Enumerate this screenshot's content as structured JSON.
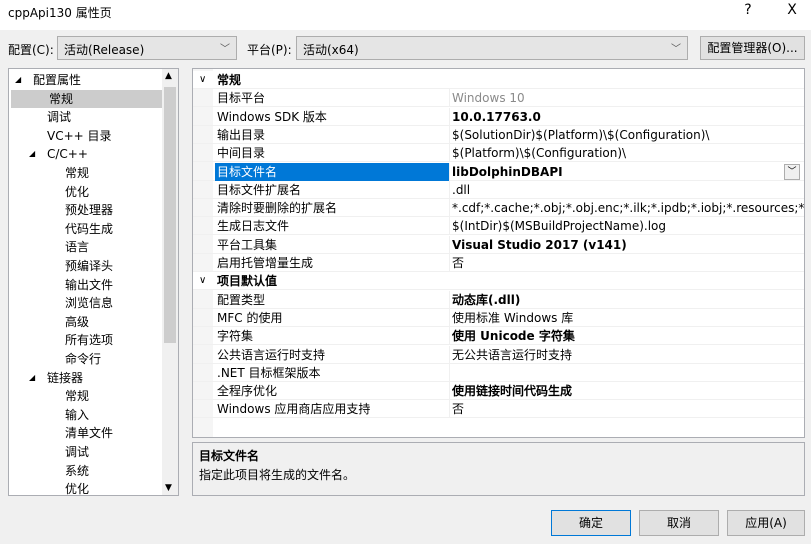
{
  "window": {
    "title": "cppApi130 属性页",
    "help": "?",
    "close": "X"
  },
  "config": {
    "label": "配置(C):",
    "value": "活动(Release)",
    "platform_label": "平台(P):",
    "platform_value": "活动(x64)",
    "manager_button": "配置管理器(O)..."
  },
  "tree": {
    "items": [
      {
        "label": "配置属性",
        "level": 0,
        "expanded": true
      },
      {
        "label": "常规",
        "level": 1,
        "selected": true
      },
      {
        "label": "调试",
        "level": 1
      },
      {
        "label": "VC++ 目录",
        "level": 1
      },
      {
        "label": "C/C++",
        "level": 1,
        "expanded": true
      },
      {
        "label": "常规",
        "level": 2
      },
      {
        "label": "优化",
        "level": 2
      },
      {
        "label": "预处理器",
        "level": 2
      },
      {
        "label": "代码生成",
        "level": 2
      },
      {
        "label": "语言",
        "level": 2
      },
      {
        "label": "预编译头",
        "level": 2
      },
      {
        "label": "输出文件",
        "level": 2
      },
      {
        "label": "浏览信息",
        "level": 2
      },
      {
        "label": "高级",
        "level": 2
      },
      {
        "label": "所有选项",
        "level": 2
      },
      {
        "label": "命令行",
        "level": 2
      },
      {
        "label": "链接器",
        "level": 1,
        "expanded": true
      },
      {
        "label": "常规",
        "level": 2
      },
      {
        "label": "输入",
        "level": 2
      },
      {
        "label": "清单文件",
        "level": 2
      },
      {
        "label": "调试",
        "level": 2
      },
      {
        "label": "系统",
        "level": 2
      },
      {
        "label": "优化",
        "level": 2
      }
    ]
  },
  "grid": {
    "rows": [
      {
        "type": "cat",
        "name": "常规"
      },
      {
        "name": "目标平台",
        "value": "Windows 10",
        "gray": true
      },
      {
        "name": "Windows SDK 版本",
        "value": "10.0.17763.0",
        "bold": true
      },
      {
        "name": "输出目录",
        "value": "$(SolutionDir)$(Platform)\\$(Configuration)\\"
      },
      {
        "name": "中间目录",
        "value": "$(Platform)\\$(Configuration)\\"
      },
      {
        "name": "目标文件名",
        "value": "libDolphinDBAPI",
        "bold": true,
        "selected": true
      },
      {
        "name": "目标文件扩展名",
        "value": ".dll"
      },
      {
        "name": "清除时要删除的扩展名",
        "value": "*.cdf;*.cache;*.obj;*.obj.enc;*.ilk;*.ipdb;*.iobj;*.resources;*.tlb;*.tli;*.t"
      },
      {
        "name": "生成日志文件",
        "value": "$(IntDir)$(MSBuildProjectName).log"
      },
      {
        "name": "平台工具集",
        "value": "Visual Studio 2017 (v141)",
        "bold": true
      },
      {
        "name": "启用托管增量生成",
        "value": "否"
      },
      {
        "type": "cat",
        "name": "项目默认值"
      },
      {
        "name": "配置类型",
        "value": "动态库(.dll)",
        "bold": true
      },
      {
        "name": "MFC 的使用",
        "value": "使用标准 Windows 库"
      },
      {
        "name": "字符集",
        "value": "使用 Unicode 字符集",
        "bold": true
      },
      {
        "name": "公共语言运行时支持",
        "value": "无公共语言运行时支持"
      },
      {
        "name": ".NET 目标框架版本",
        "value": ""
      },
      {
        "name": "全程序优化",
        "value": "使用链接时间代码生成",
        "bold": true
      },
      {
        "name": "Windows 应用商店应用支持",
        "value": "否"
      }
    ]
  },
  "description": {
    "title": "目标文件名",
    "text": "指定此项目将生成的文件名。"
  },
  "buttons": {
    "ok": "确定",
    "cancel": "取消",
    "apply": "应用(A)"
  }
}
